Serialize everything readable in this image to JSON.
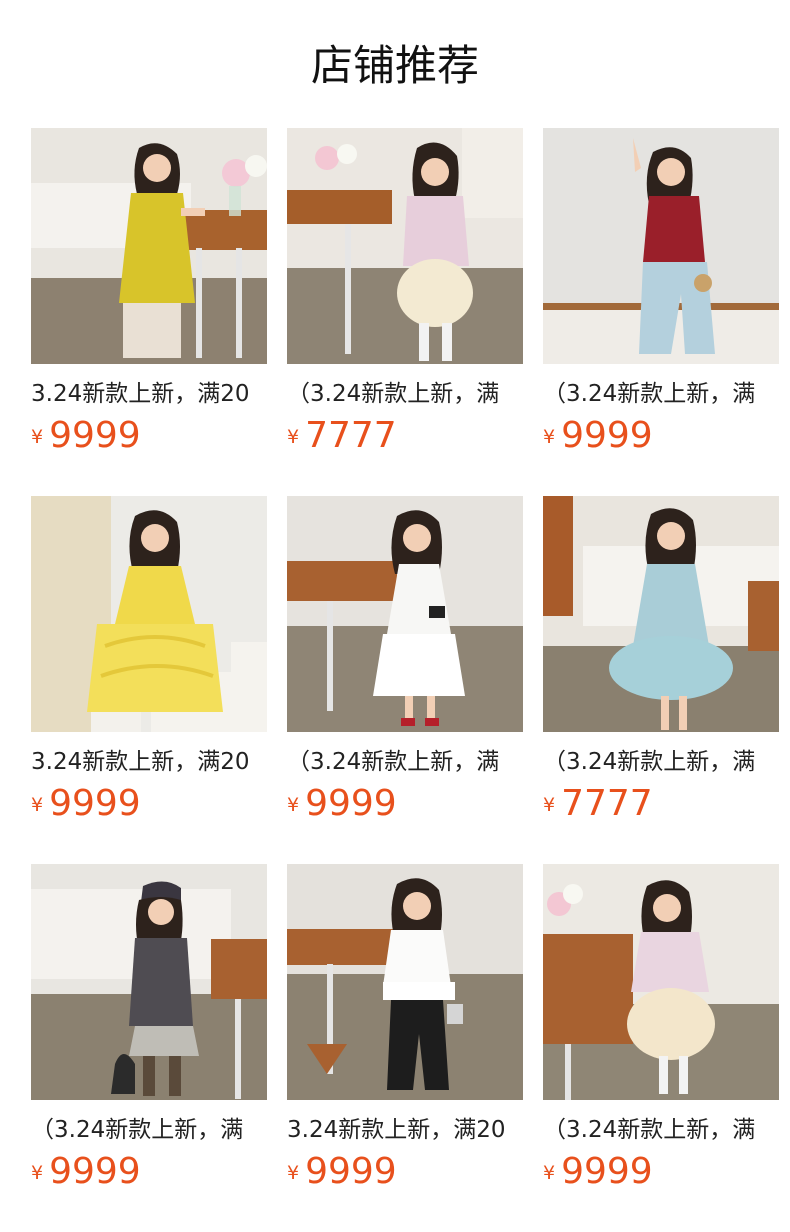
{
  "section": {
    "title": "店铺推荐"
  },
  "theme": {
    "price_color": "#e8501c"
  },
  "products": [
    {
      "title": "3.24新款上新，满20",
      "currency": "¥",
      "price": "9999",
      "image": "girl-yellow-slip-dress"
    },
    {
      "title": "（3.24新款上新，满",
      "currency": "¥",
      "price": "7777",
      "image": "girl-pink-jacket-tulle-skirt"
    },
    {
      "title": "（3.24新款上新，满",
      "currency": "¥",
      "price": "9999",
      "image": "girl-red-top-wide-jeans"
    },
    {
      "title": "3.24新款上新，满20",
      "currency": "¥",
      "price": "9999",
      "image": "girl-yellow-princess-gown"
    },
    {
      "title": "（3.24新款上新，满",
      "currency": "¥",
      "price": "9999",
      "image": "girl-white-layered-dress"
    },
    {
      "title": "（3.24新款上新，满",
      "currency": "¥",
      "price": "7777",
      "image": "girl-blue-tulle-dress"
    },
    {
      "title": "（3.24新款上新，满",
      "currency": "¥",
      "price": "9999",
      "image": "girl-grey-top-skirt"
    },
    {
      "title": "3.24新款上新，满20",
      "currency": "¥",
      "price": "9999",
      "image": "girl-white-tee-black-pants"
    },
    {
      "title": "（3.24新款上新，满",
      "currency": "¥",
      "price": "9999",
      "image": "girl-pink-cardigan-tulle"
    }
  ]
}
